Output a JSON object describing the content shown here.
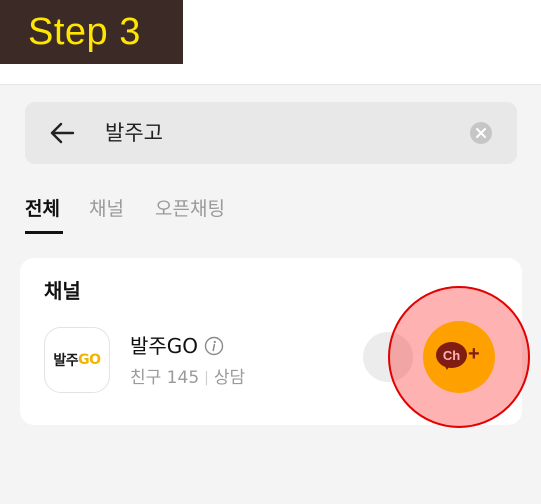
{
  "banner": {
    "text": "Step 3"
  },
  "search": {
    "query": "발주고"
  },
  "tabs": [
    {
      "label": "전체",
      "active": true
    },
    {
      "label": "채널",
      "active": false
    },
    {
      "label": "오픈채팅",
      "active": false
    }
  ],
  "section": {
    "title": "채널"
  },
  "channel": {
    "logo_text_1": "발주",
    "logo_text_2": "GO",
    "name": "발주GO",
    "friends": "친구 145",
    "separator": "|",
    "consult": "상담"
  },
  "add_button": {
    "label_ch": "Ch",
    "label_plus": "+"
  },
  "icons": {
    "back": "back-arrow-icon",
    "clear": "clear-icon",
    "info": "info-icon",
    "add_channel": "channel-add-icon"
  },
  "colors": {
    "banner_background": "#3c2a26",
    "banner_text": "#ffe600",
    "kakao_yellow": "#fee500",
    "highlight": "#e30000"
  }
}
